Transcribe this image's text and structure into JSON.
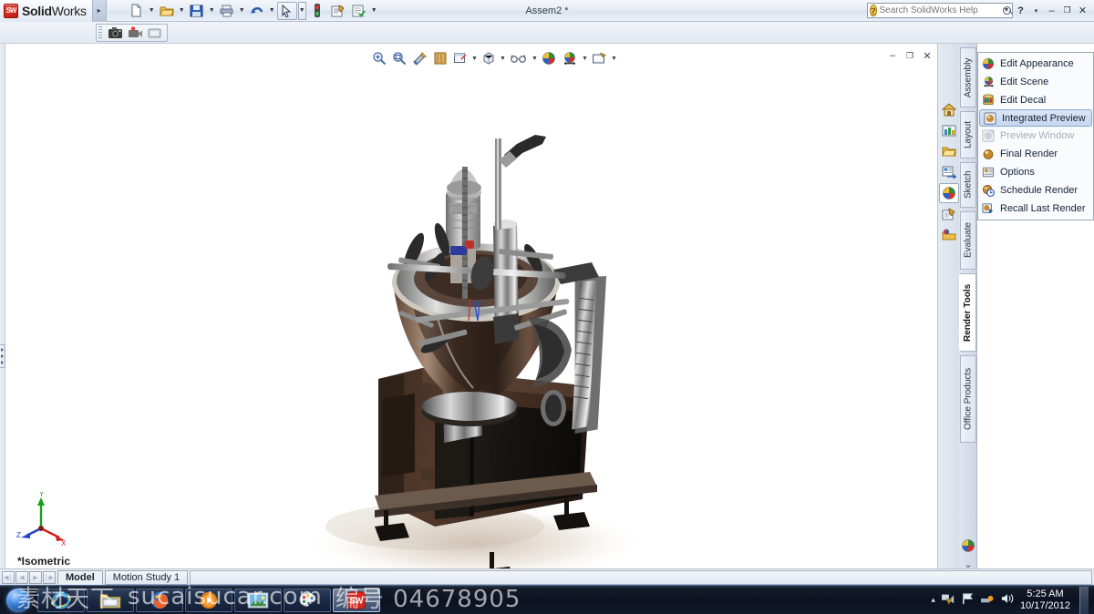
{
  "app": {
    "brand_bold": "Solid",
    "brand_light": "Works",
    "document_title": "Assem2 *",
    "logo_text": "SW"
  },
  "titlebar": {
    "menu_arrow": "▸",
    "buttons": [
      {
        "name": "new-document",
        "icon": "page",
        "caret": true
      },
      {
        "name": "open-document",
        "icon": "folder",
        "caret": true
      },
      {
        "name": "save-document",
        "icon": "floppy",
        "caret": true
      },
      {
        "name": "print-document",
        "icon": "printer",
        "caret": true
      },
      {
        "name": "undo",
        "icon": "undo",
        "caret": true
      },
      {
        "name": "select",
        "icon": "arrow",
        "caret": true
      },
      {
        "name": "rebuild",
        "icon": "traffic-light",
        "caret": false
      },
      {
        "name": "options",
        "icon": "options",
        "caret": false
      },
      {
        "name": "customize",
        "icon": "list-check",
        "caret": true
      }
    ],
    "search": {
      "placeholder": "Search SolidWorks Help",
      "value": "",
      "help_label": "?",
      "help_caret": "▾"
    },
    "window_controls": {
      "minimize": "–",
      "restore": "❐",
      "close": "✕"
    }
  },
  "secondary_toolbar": {
    "buttons": [
      {
        "name": "screen-capture-camera",
        "icon": "camera"
      },
      {
        "name": "record-video",
        "icon": "camcorder"
      },
      {
        "name": "capture-settings",
        "icon": "capture-frame"
      }
    ]
  },
  "viewport_toolbar": {
    "buttons": [
      {
        "name": "zoom-to-fit",
        "icon": "zoom-fit",
        "caret": false
      },
      {
        "name": "zoom-to-area",
        "icon": "zoom-area",
        "caret": false
      },
      {
        "name": "section-view",
        "icon": "section-view",
        "caret": false
      },
      {
        "name": "view-orientation",
        "icon": "view-orientation",
        "caret": false
      },
      {
        "name": "display-style",
        "icon": "display-style",
        "caret": true
      },
      {
        "name": "hide-show-items",
        "icon": "hide-show",
        "caret": true
      },
      {
        "name": "edit-appearance-view",
        "icon": "glasses",
        "caret": true
      },
      {
        "name": "apply-scene",
        "icon": "color-sphere",
        "caret": false
      },
      {
        "name": "view-settings",
        "icon": "scene-ball",
        "caret": true
      },
      {
        "name": "viewport-layout",
        "icon": "viewport",
        "caret": true
      }
    ],
    "document_controls": {
      "minimize": "–",
      "restore": "❐",
      "close": "✕"
    }
  },
  "graphics_area": {
    "view_name": "*Isometric",
    "triad": {
      "x_label": "X",
      "y_label": "Y",
      "z_label": "Z"
    },
    "model_description": "Rendered 3D assembly of an industrial mixing machine"
  },
  "task_pane": {
    "icons": [
      {
        "name": "solidworks-resources-icon",
        "glyph": "home",
        "selected": false
      },
      {
        "name": "design-library-icon",
        "glyph": "library",
        "selected": false
      },
      {
        "name": "file-explorer-icon",
        "glyph": "folder",
        "selected": false
      },
      {
        "name": "view-palette-icon",
        "glyph": "palette-view",
        "selected": false
      },
      {
        "name": "appearances-scenes-icon",
        "glyph": "color-sphere",
        "selected": true
      },
      {
        "name": "custom-properties-icon",
        "glyph": "properties",
        "selected": false
      },
      {
        "name": "photoview-items-icon",
        "glyph": "render-folder",
        "selected": false
      }
    ],
    "bottom": [
      {
        "name": "appearances-shortcut-icon",
        "glyph": "color-sphere"
      },
      {
        "name": "expand-chevron-icon",
        "glyph": "⌄"
      }
    ]
  },
  "command_tabs": [
    {
      "name": "tab-assembly",
      "label": "Assembly",
      "active": false
    },
    {
      "name": "tab-layout",
      "label": "Layout",
      "active": false
    },
    {
      "name": "tab-sketch",
      "label": "Sketch",
      "active": false
    },
    {
      "name": "tab-evaluate",
      "label": "Evaluate",
      "active": false
    },
    {
      "name": "tab-render-tools",
      "label": "Render Tools",
      "active": true
    },
    {
      "name": "tab-office-products",
      "label": "Office Products",
      "active": false
    }
  ],
  "render_menu": {
    "items": [
      {
        "name": "edit-appearance",
        "label": "Edit Appearance",
        "icon": "color-sphere",
        "selected": false,
        "disabled": false
      },
      {
        "name": "edit-scene",
        "label": "Edit Scene",
        "icon": "scene-ball",
        "selected": false,
        "disabled": false
      },
      {
        "name": "edit-decal",
        "label": "Edit Decal",
        "icon": "decal-barrel",
        "selected": false,
        "disabled": false
      },
      {
        "name": "integrated-preview",
        "label": "Integrated Preview",
        "icon": "preview-sphere",
        "selected": true,
        "disabled": false
      },
      {
        "name": "preview-window",
        "label": "Preview Window",
        "icon": "preview-window",
        "selected": false,
        "disabled": true
      },
      {
        "name": "final-render",
        "label": "Final Render",
        "icon": "render-sphere",
        "selected": false,
        "disabled": false
      },
      {
        "name": "options",
        "label": "Options",
        "icon": "options-card",
        "selected": false,
        "disabled": false
      },
      {
        "name": "schedule-render",
        "label": "Schedule Render",
        "icon": "clock-sphere",
        "selected": false,
        "disabled": false
      },
      {
        "name": "recall-last-render",
        "label": "Recall Last Render",
        "icon": "recall-sphere",
        "selected": false,
        "disabled": false
      }
    ]
  },
  "status_bar": {
    "nav": [
      "◀│",
      "◀",
      "▶",
      "│▶"
    ],
    "tabs": [
      {
        "name": "tab-model",
        "label": "Model",
        "active": true
      },
      {
        "name": "tab-motion-study-1",
        "label": "Motion Study 1",
        "active": false
      }
    ]
  },
  "taskbar": {
    "start_label": "Start",
    "items": [
      {
        "name": "taskbar-internet-explorer",
        "icon": "ie"
      },
      {
        "name": "taskbar-explorer",
        "icon": "explorer"
      },
      {
        "name": "taskbar-firefox",
        "icon": "firefox"
      },
      {
        "name": "taskbar-media-player",
        "icon": "media"
      },
      {
        "name": "taskbar-photo-viewer",
        "icon": "photo"
      },
      {
        "name": "taskbar-paint",
        "icon": "paint"
      },
      {
        "name": "taskbar-solidworks",
        "icon": "solidworks",
        "active": true
      }
    ],
    "tray": [
      {
        "name": "tray-expand-icon",
        "glyph": "▴"
      },
      {
        "name": "tray-network-icon",
        "glyph": "network"
      },
      {
        "name": "tray-action-center-icon",
        "glyph": "flag"
      },
      {
        "name": "tray-power-icon",
        "glyph": "power"
      },
      {
        "name": "tray-volume-icon",
        "glyph": "volume"
      }
    ],
    "clock": {
      "time": "5:25 AM",
      "date": "10/17/2012"
    }
  },
  "watermark": {
    "text_left": "素材天下",
    "text_mid": "sucaisucar.com",
    "text_right": "编号 04678905"
  },
  "colors": {
    "accent_blue": "#3e87e0",
    "brand_red": "#c01b13",
    "highlight": "#c6d7ef",
    "taskbar": "#0b1120"
  }
}
